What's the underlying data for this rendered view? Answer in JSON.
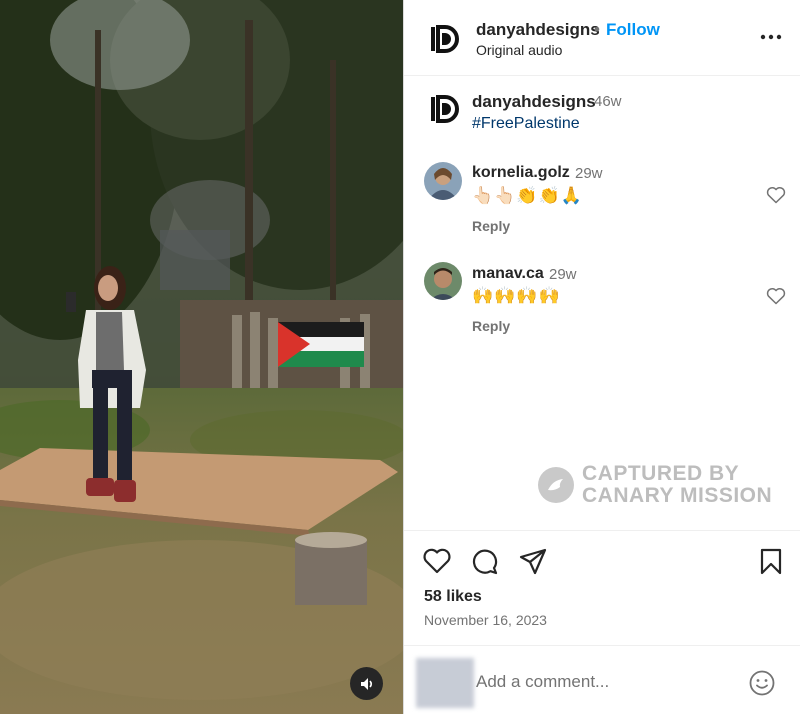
{
  "header": {
    "username": "danyahdesigns",
    "separator": "•",
    "follow_label": "Follow",
    "audio_label": "Original audio",
    "more_icon": "more-horizontal-icon"
  },
  "caption": {
    "username": "danyahdesigns",
    "time": "46w",
    "hashtag": "#FreePalestine"
  },
  "comments": [
    {
      "username": "kornelia.golz",
      "time": "29w",
      "text": "👆🏻👆🏻👏👏🙏",
      "reply_label": "Reply"
    },
    {
      "username": "manav.ca",
      "time": "29w",
      "text": "🙌🙌🙌🙌",
      "reply_label": "Reply"
    }
  ],
  "watermark": {
    "line1": "CAPTURED BY",
    "line2": "CANARY MISSION"
  },
  "actions": {
    "icons": [
      "heart-icon",
      "comment-icon",
      "share-icon",
      "bookmark-icon"
    ]
  },
  "stats": {
    "likes": "58 likes",
    "date": "November 16, 2023"
  },
  "comment_box": {
    "placeholder": "Add a comment...",
    "emoji_icon": "smiley-icon"
  },
  "media": {
    "sound_icon": "speaker-icon",
    "flag_colors": [
      "#000000",
      "#ffffff",
      "#149954",
      "#e4312b"
    ]
  }
}
